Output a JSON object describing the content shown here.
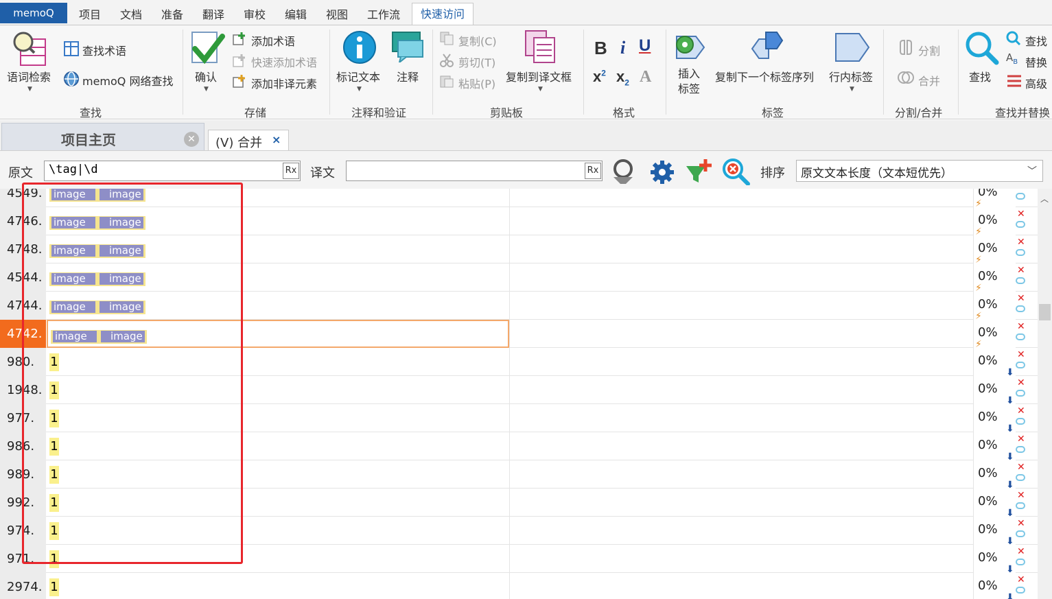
{
  "menubar": {
    "app": "memoQ",
    "items": [
      "项目",
      "文档",
      "准备",
      "翻译",
      "审校",
      "编辑",
      "视图",
      "工作流",
      "快速访问"
    ]
  },
  "ribbon": {
    "lookup": {
      "term_search": "语词检索",
      "find_terms": "查找术语",
      "web_search": "memoQ 网络查找",
      "group": "查找"
    },
    "store": {
      "confirm": "确认",
      "add_term": "添加术语",
      "quick_add_term": "快速添加术语",
      "add_nontrans": "添加非译元素",
      "group": "存储"
    },
    "comments": {
      "mark_text": "标记文本",
      "comment": "注释",
      "group": "注释和验证"
    },
    "clipboard": {
      "copy": "复制(C)",
      "cut": "剪切(T)",
      "paste": "粘贴(P)",
      "copy_to_target": "复制到译文框",
      "group": "剪贴板"
    },
    "format": {
      "group": "格式"
    },
    "tags": {
      "insert_tag": "插入\n标签",
      "copy_next_tag": "复制下一个标签序列",
      "inline_tags": "行内标签",
      "group": "标签"
    },
    "split": {
      "split": "分割",
      "join": "合并",
      "group": "分割/合并"
    },
    "find": {
      "find_big": "查找",
      "find": "查找",
      "replace": "替换",
      "advanced": "高级",
      "group": "查找并替换"
    }
  },
  "tabs": {
    "home": "项目主页",
    "merge": "(V) 合并"
  },
  "filter": {
    "source_label": "原文",
    "source_value": "\\tag|\\d",
    "rx": "Rx",
    "target_label": "译文",
    "target_value": "",
    "sort_label": "排序",
    "sort_value": "原文文本长度（文本短优先）"
  },
  "rows": [
    {
      "num": "4549.",
      "kind": "tag",
      "match": "0%"
    },
    {
      "num": "4746.",
      "kind": "tag",
      "match": "0%"
    },
    {
      "num": "4748.",
      "kind": "tag",
      "match": "0%"
    },
    {
      "num": "4544.",
      "kind": "tag",
      "match": "0%"
    },
    {
      "num": "4744.",
      "kind": "tag",
      "match": "0%"
    },
    {
      "num": "4742.",
      "kind": "tag",
      "match": "0%",
      "selected": true
    },
    {
      "num": "980.",
      "kind": "digit",
      "match": "0%"
    },
    {
      "num": "1948.",
      "kind": "digit",
      "match": "0%"
    },
    {
      "num": "977.",
      "kind": "digit",
      "match": "0%"
    },
    {
      "num": "986.",
      "kind": "digit",
      "match": "0%"
    },
    {
      "num": "989.",
      "kind": "digit",
      "match": "0%"
    },
    {
      "num": "992.",
      "kind": "digit",
      "match": "0%"
    },
    {
      "num": "974.",
      "kind": "digit",
      "match": "0%"
    },
    {
      "num": "971.",
      "kind": "digit",
      "match": "0%"
    },
    {
      "num": "2974.",
      "kind": "digit",
      "match": "0%"
    }
  ],
  "tag_text": "image",
  "digit_text": "1"
}
